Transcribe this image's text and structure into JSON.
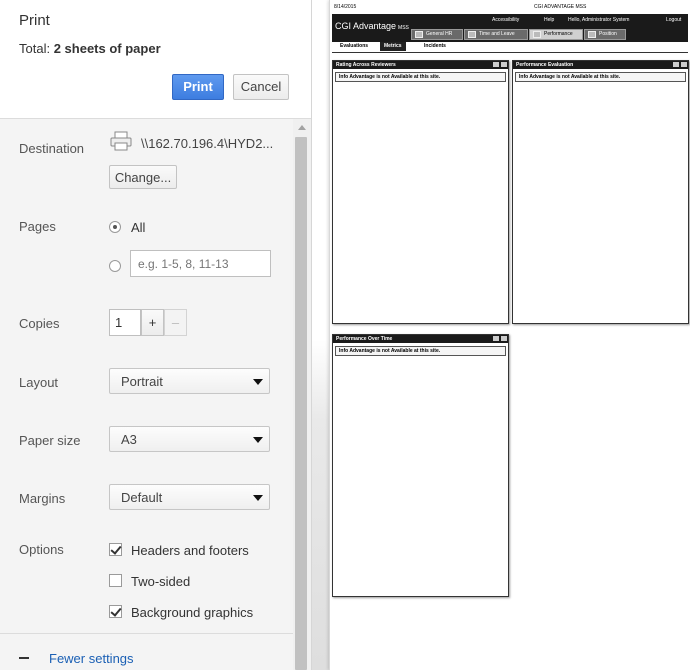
{
  "dialog": {
    "title": "Print",
    "total_label": "Total:",
    "total_value": "2 sheets of paper",
    "print_button": "Print",
    "cancel_button": "Cancel"
  },
  "destination": {
    "label": "Destination",
    "value": "\\\\162.70.196.4\\HYD2...",
    "change_button": "Change..."
  },
  "pages": {
    "label": "Pages",
    "all_label": "All",
    "all_selected": true,
    "range_placeholder": "e.g. 1-5, 8, 11-13"
  },
  "copies": {
    "label": "Copies",
    "value": "1",
    "plus": "+",
    "minus": "–"
  },
  "layout": {
    "label": "Layout",
    "value": "Portrait"
  },
  "paper_size": {
    "label": "Paper size",
    "value": "A3"
  },
  "margins": {
    "label": "Margins",
    "value": "Default"
  },
  "options": {
    "label": "Options",
    "items": [
      {
        "label": "Headers and footers",
        "checked": true
      },
      {
        "label": "Two-sided",
        "checked": false
      },
      {
        "label": "Background graphics",
        "checked": true
      }
    ]
  },
  "fewer_settings": "Fewer settings",
  "preview": {
    "date": "8/14/2015",
    "app_name": "CGI ADVANTAGE MSS",
    "brand": "CGI Advantage",
    "brand_sub": "MSS",
    "top_links": [
      "Accessibility",
      "Help",
      "Hello, Administrator System",
      "Logout"
    ],
    "main_tabs": [
      "General HR",
      "Time and Leave",
      "Performance",
      "Position"
    ],
    "active_main_tab": "Performance",
    "sub_tabs": [
      "Evaluations",
      "Metrics",
      "Incidents"
    ],
    "active_sub_tab": "Metrics",
    "portlets": [
      {
        "title": "Rating Across Reviewers",
        "message": "Info Advantage is not Available at this site."
      },
      {
        "title": "Performance Evaluation",
        "message": "Info Advantage is not Available at this site."
      },
      {
        "title": "Performance Over Time",
        "message": "Info Advantage is not Available at this site."
      }
    ]
  }
}
